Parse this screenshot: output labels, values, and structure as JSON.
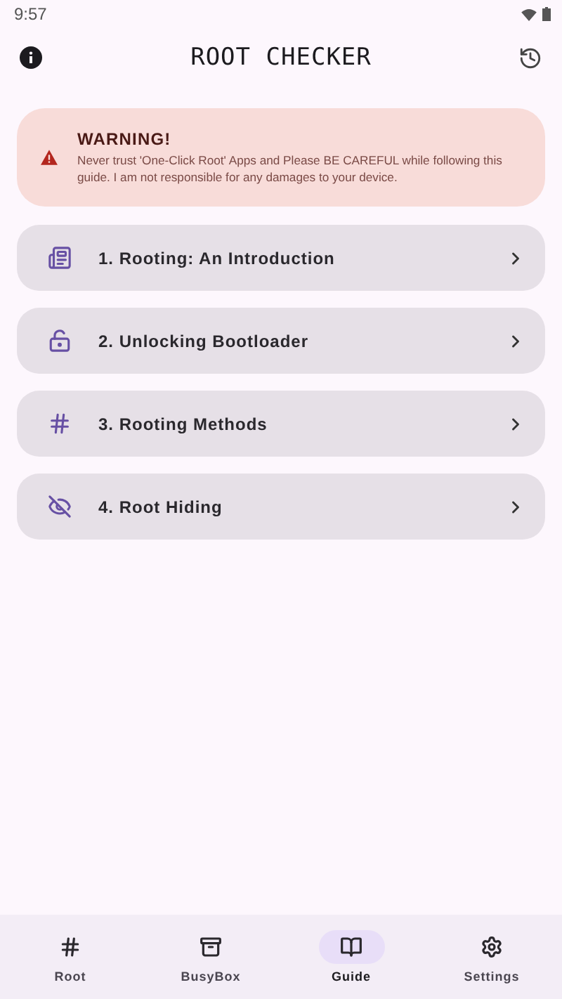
{
  "status_bar": {
    "time": "9:57"
  },
  "header": {
    "title": "ROOT CHECKER"
  },
  "warning": {
    "title": "WARNING!",
    "message": "Never trust 'One-Click Root' Apps and Please BE CAREFUL while following this guide. I am not responsible for any damages to your device."
  },
  "guide_items": [
    {
      "label": "1. Rooting: An Introduction"
    },
    {
      "label": "2. Unlocking Bootloader"
    },
    {
      "label": "3. Rooting Methods"
    },
    {
      "label": "4. Root Hiding"
    }
  ],
  "nav": [
    {
      "label": "Root",
      "selected": false
    },
    {
      "label": "BusyBox",
      "selected": false
    },
    {
      "label": "Guide",
      "selected": true
    },
    {
      "label": "Settings",
      "selected": false
    }
  ]
}
